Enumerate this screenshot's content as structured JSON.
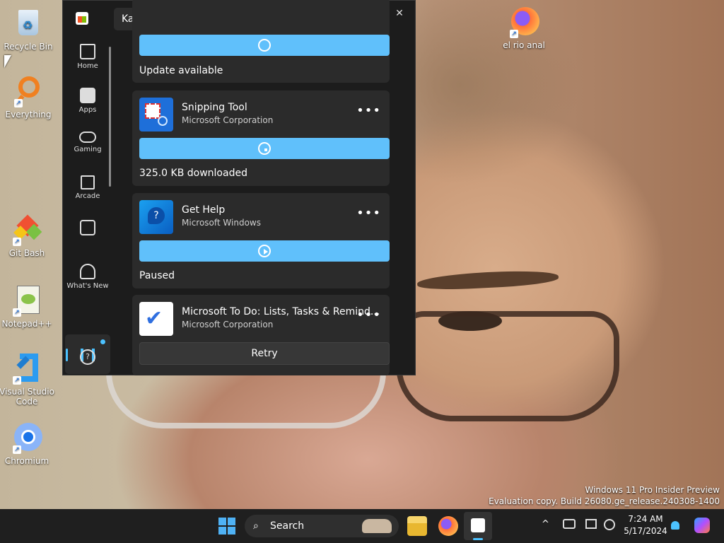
{
  "desktop": {
    "icons": [
      {
        "label": "Recycle Bin"
      },
      {
        "label": "Everything"
      },
      {
        "label": "Git Bash"
      },
      {
        "label": "Notepad++"
      },
      {
        "label": "Visual Studio Code"
      },
      {
        "label": "Chromium"
      },
      {
        "label": "el rio anal"
      }
    ],
    "watermark_line1": "Windows 11 Pro Insider Preview",
    "watermark_line2": "Evaluation copy. Build 26080.ge_release.240308-1400"
  },
  "store": {
    "search_value": "Kaufcom",
    "window_buttons": {
      "minimize": "—",
      "maximize": "☐",
      "close": "✕"
    },
    "nav": [
      {
        "label": "Home"
      },
      {
        "label": "Apps"
      },
      {
        "label": "Gaming"
      },
      {
        "label": "Arcade"
      },
      {
        "label": "What's New"
      }
    ],
    "help_glyph": "?",
    "downloads": [
      {
        "status": "Update available"
      },
      {
        "name": "Snipping Tool",
        "publisher": "Microsoft Corporation",
        "status": "325.0 KB downloaded"
      },
      {
        "name": "Get Help",
        "publisher": "Microsoft Windows",
        "status": "Paused",
        "icon_glyph": "?"
      },
      {
        "name": "Microsoft To Do: Lists, Tasks & Remind...",
        "publisher": "Microsoft Corporation",
        "action": "Retry",
        "icon_glyph": "✔"
      }
    ],
    "more_glyph": "•••"
  },
  "taskbar": {
    "search_label": "Search",
    "time": "7:24 AM",
    "date": "5/17/2024",
    "chevron": "^"
  },
  "colors": {
    "accent": "#4cc2ff",
    "progress": "#60c0fb",
    "window_bg": "#1c1c1c",
    "card_bg": "#2b2b2b"
  }
}
